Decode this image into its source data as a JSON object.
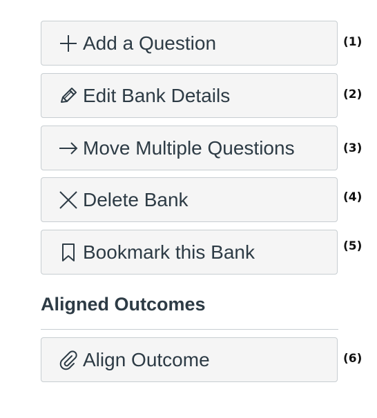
{
  "buttons": [
    {
      "label": "Add a Question",
      "number": "(1)",
      "icon": "plus-icon"
    },
    {
      "label": "Edit Bank Details",
      "number": "(2)",
      "icon": "pencil-icon"
    },
    {
      "label": "Move Multiple Questions",
      "number": "(3)",
      "icon": "arrow-right-icon"
    },
    {
      "label": "Delete Bank",
      "number": "(4)",
      "icon": "x-icon"
    },
    {
      "label": "Bookmark this Bank",
      "number": "(5)",
      "icon": "bookmark-icon"
    }
  ],
  "outcomes": {
    "heading": "Aligned Outcomes",
    "button": {
      "label": "Align Outcome",
      "number": "(6)",
      "icon": "paperclip-icon"
    }
  },
  "colors": {
    "button_bg": "#f5f5f5",
    "button_border": "#c7cdd1",
    "text": "#2d3b45"
  }
}
